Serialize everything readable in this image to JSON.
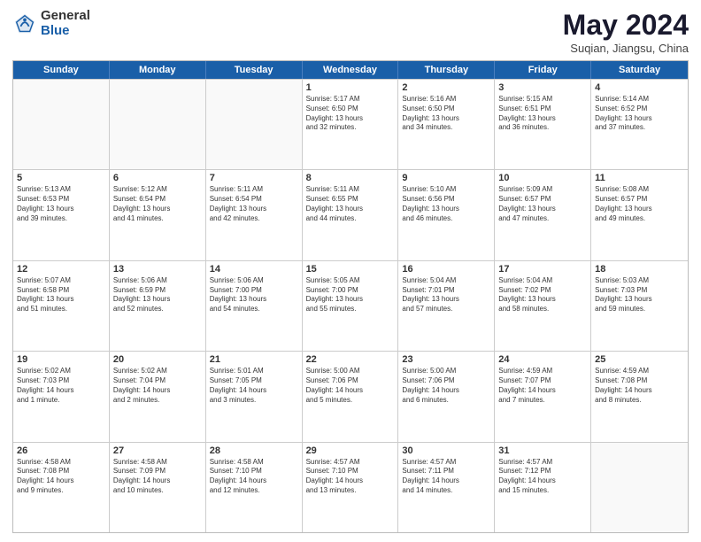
{
  "header": {
    "logo_general": "General",
    "logo_blue": "Blue",
    "title": "May 2024",
    "location": "Suqian, Jiangsu, China"
  },
  "weekdays": [
    "Sunday",
    "Monday",
    "Tuesday",
    "Wednesday",
    "Thursday",
    "Friday",
    "Saturday"
  ],
  "rows": [
    [
      {
        "day": "",
        "text": ""
      },
      {
        "day": "",
        "text": ""
      },
      {
        "day": "",
        "text": ""
      },
      {
        "day": "1",
        "text": "Sunrise: 5:17 AM\nSunset: 6:50 PM\nDaylight: 13 hours\nand 32 minutes."
      },
      {
        "day": "2",
        "text": "Sunrise: 5:16 AM\nSunset: 6:50 PM\nDaylight: 13 hours\nand 34 minutes."
      },
      {
        "day": "3",
        "text": "Sunrise: 5:15 AM\nSunset: 6:51 PM\nDaylight: 13 hours\nand 36 minutes."
      },
      {
        "day": "4",
        "text": "Sunrise: 5:14 AM\nSunset: 6:52 PM\nDaylight: 13 hours\nand 37 minutes."
      }
    ],
    [
      {
        "day": "5",
        "text": "Sunrise: 5:13 AM\nSunset: 6:53 PM\nDaylight: 13 hours\nand 39 minutes."
      },
      {
        "day": "6",
        "text": "Sunrise: 5:12 AM\nSunset: 6:54 PM\nDaylight: 13 hours\nand 41 minutes."
      },
      {
        "day": "7",
        "text": "Sunrise: 5:11 AM\nSunset: 6:54 PM\nDaylight: 13 hours\nand 42 minutes."
      },
      {
        "day": "8",
        "text": "Sunrise: 5:11 AM\nSunset: 6:55 PM\nDaylight: 13 hours\nand 44 minutes."
      },
      {
        "day": "9",
        "text": "Sunrise: 5:10 AM\nSunset: 6:56 PM\nDaylight: 13 hours\nand 46 minutes."
      },
      {
        "day": "10",
        "text": "Sunrise: 5:09 AM\nSunset: 6:57 PM\nDaylight: 13 hours\nand 47 minutes."
      },
      {
        "day": "11",
        "text": "Sunrise: 5:08 AM\nSunset: 6:57 PM\nDaylight: 13 hours\nand 49 minutes."
      }
    ],
    [
      {
        "day": "12",
        "text": "Sunrise: 5:07 AM\nSunset: 6:58 PM\nDaylight: 13 hours\nand 51 minutes."
      },
      {
        "day": "13",
        "text": "Sunrise: 5:06 AM\nSunset: 6:59 PM\nDaylight: 13 hours\nand 52 minutes."
      },
      {
        "day": "14",
        "text": "Sunrise: 5:06 AM\nSunset: 7:00 PM\nDaylight: 13 hours\nand 54 minutes."
      },
      {
        "day": "15",
        "text": "Sunrise: 5:05 AM\nSunset: 7:00 PM\nDaylight: 13 hours\nand 55 minutes."
      },
      {
        "day": "16",
        "text": "Sunrise: 5:04 AM\nSunset: 7:01 PM\nDaylight: 13 hours\nand 57 minutes."
      },
      {
        "day": "17",
        "text": "Sunrise: 5:04 AM\nSunset: 7:02 PM\nDaylight: 13 hours\nand 58 minutes."
      },
      {
        "day": "18",
        "text": "Sunrise: 5:03 AM\nSunset: 7:03 PM\nDaylight: 13 hours\nand 59 minutes."
      }
    ],
    [
      {
        "day": "19",
        "text": "Sunrise: 5:02 AM\nSunset: 7:03 PM\nDaylight: 14 hours\nand 1 minute."
      },
      {
        "day": "20",
        "text": "Sunrise: 5:02 AM\nSunset: 7:04 PM\nDaylight: 14 hours\nand 2 minutes."
      },
      {
        "day": "21",
        "text": "Sunrise: 5:01 AM\nSunset: 7:05 PM\nDaylight: 14 hours\nand 3 minutes."
      },
      {
        "day": "22",
        "text": "Sunrise: 5:00 AM\nSunset: 7:06 PM\nDaylight: 14 hours\nand 5 minutes."
      },
      {
        "day": "23",
        "text": "Sunrise: 5:00 AM\nSunset: 7:06 PM\nDaylight: 14 hours\nand 6 minutes."
      },
      {
        "day": "24",
        "text": "Sunrise: 4:59 AM\nSunset: 7:07 PM\nDaylight: 14 hours\nand 7 minutes."
      },
      {
        "day": "25",
        "text": "Sunrise: 4:59 AM\nSunset: 7:08 PM\nDaylight: 14 hours\nand 8 minutes."
      }
    ],
    [
      {
        "day": "26",
        "text": "Sunrise: 4:58 AM\nSunset: 7:08 PM\nDaylight: 14 hours\nand 9 minutes."
      },
      {
        "day": "27",
        "text": "Sunrise: 4:58 AM\nSunset: 7:09 PM\nDaylight: 14 hours\nand 10 minutes."
      },
      {
        "day": "28",
        "text": "Sunrise: 4:58 AM\nSunset: 7:10 PM\nDaylight: 14 hours\nand 12 minutes."
      },
      {
        "day": "29",
        "text": "Sunrise: 4:57 AM\nSunset: 7:10 PM\nDaylight: 14 hours\nand 13 minutes."
      },
      {
        "day": "30",
        "text": "Sunrise: 4:57 AM\nSunset: 7:11 PM\nDaylight: 14 hours\nand 14 minutes."
      },
      {
        "day": "31",
        "text": "Sunrise: 4:57 AM\nSunset: 7:12 PM\nDaylight: 14 hours\nand 15 minutes."
      },
      {
        "day": "",
        "text": ""
      }
    ]
  ]
}
